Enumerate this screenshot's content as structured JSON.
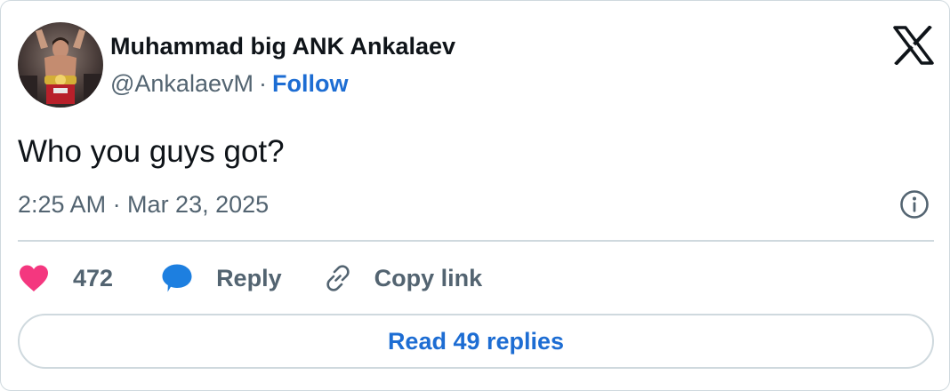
{
  "tweet": {
    "author": {
      "display_name": "Muhammad big ANK Ankalaev",
      "handle": "@AnkalaevM",
      "separator": "·",
      "follow_label": "Follow"
    },
    "text": "Who you guys got?",
    "timestamp": "2:25 AM · Mar 23, 2025",
    "actions": {
      "like_count": "472",
      "reply_label": "Reply",
      "copy_link_label": "Copy link"
    },
    "read_replies_label": "Read 49 replies"
  },
  "icons": {
    "brand": "x-logo-icon",
    "info": "info-icon",
    "like": "heart-icon",
    "reply": "speech-bubble-icon",
    "copy_link": "link-icon"
  },
  "colors": {
    "accent": "#1d6dd3",
    "heart": "#f4377f",
    "reply_bubble": "#1d7fe0",
    "secondary_text": "#536471",
    "border": "#cfd9de"
  }
}
